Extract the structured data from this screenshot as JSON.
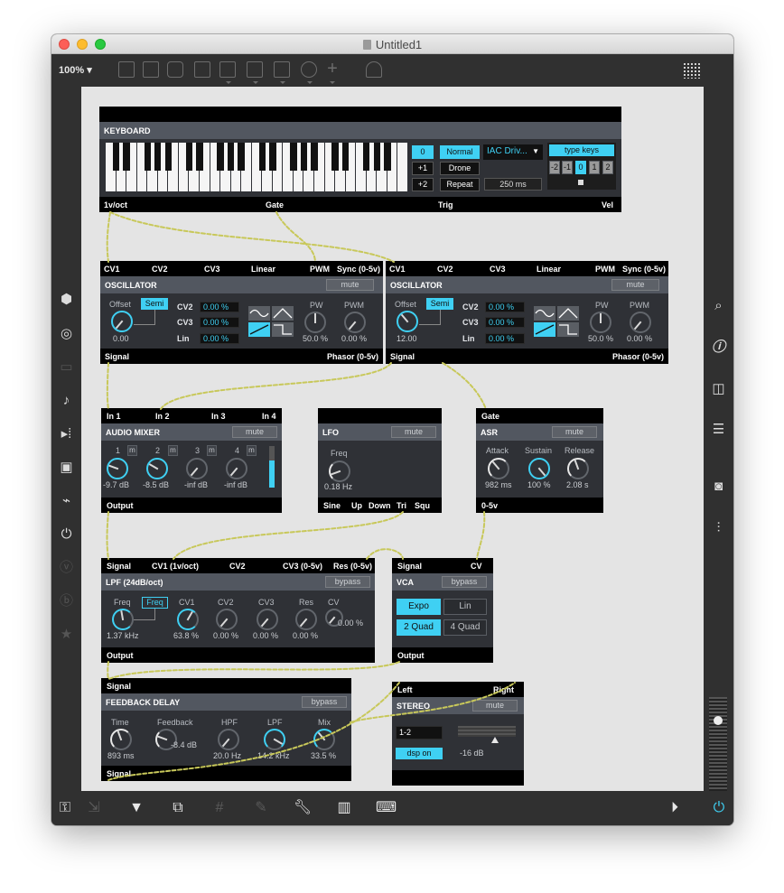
{
  "window": {
    "title": "Untitled1",
    "zoom": "100%"
  },
  "keyboard": {
    "name": "KEYBOARD",
    "octave_buttons": [
      "0",
      "+1",
      "+2"
    ],
    "mode_buttons": [
      "Normal",
      "Drone",
      "Repeat"
    ],
    "midi_device": "IAC Driv...",
    "repeat_time": "250 ms",
    "type_keys_label": "type keys",
    "type_keys_octaves": [
      "-2",
      "-1",
      "0",
      "1",
      "2"
    ],
    "outputs": [
      "1v/oct",
      "Gate",
      "Trig",
      "Vel"
    ]
  },
  "osc1": {
    "inputs": [
      "CV1",
      "CV2",
      "CV3",
      "Linear",
      "PWM",
      "Sync (0-5v)"
    ],
    "name": "OSCILLATOR",
    "mute_label": "mute",
    "offset_label": "Offset",
    "semi_label": "Semi",
    "offset_value": "0.00",
    "cv_rows": [
      {
        "label": "CV2",
        "value": "0.00 %"
      },
      {
        "label": "CV3",
        "value": "0.00 %"
      },
      {
        "label": "Lin",
        "value": "0.00 %"
      }
    ],
    "pw_label": "PW",
    "pw_value": "50.0 %",
    "pwm_label": "PWM",
    "pwm_value": "0.00 %",
    "outputs": [
      "Signal",
      "Phasor (0-5v)"
    ]
  },
  "osc2": {
    "inputs": [
      "CV1",
      "CV2",
      "CV3",
      "Linear",
      "PWM",
      "Sync (0-5v)"
    ],
    "name": "OSCILLATOR",
    "mute_label": "mute",
    "offset_label": "Offset",
    "semi_label": "Semi",
    "offset_value": "12.00",
    "cv_rows": [
      {
        "label": "CV2",
        "value": "0.00 %"
      },
      {
        "label": "CV3",
        "value": "0.00 %"
      },
      {
        "label": "Lin",
        "value": "0.00 %"
      }
    ],
    "pw_label": "PW",
    "pw_value": "50.0 %",
    "pwm_label": "PWM",
    "pwm_value": "0.00 %",
    "outputs": [
      "Signal",
      "Phasor (0-5v)"
    ]
  },
  "mixer": {
    "inputs": [
      "In 1",
      "In 2",
      "In 3",
      "In 4"
    ],
    "name": "AUDIO MIXER",
    "mute_label": "mute",
    "channels": [
      {
        "num": "1",
        "m": "m",
        "value": "-9.7 dB"
      },
      {
        "num": "2",
        "m": "m",
        "value": "-8.5 dB"
      },
      {
        "num": "3",
        "m": "m",
        "value": "-inf dB"
      },
      {
        "num": "4",
        "m": "m",
        "value": "-inf dB"
      }
    ],
    "output": "Output"
  },
  "lfo": {
    "name": "LFO",
    "mute_label": "mute",
    "freq_label": "Freq",
    "freq_value": "0.18 Hz",
    "outputs": [
      "Sine",
      "Up",
      "Down",
      "Tri",
      "Squ"
    ]
  },
  "asr": {
    "input": "Gate",
    "name": "ASR",
    "mute_label": "mute",
    "params": [
      {
        "label": "Attack",
        "value": "982 ms"
      },
      {
        "label": "Sustain",
        "value": "100 %"
      },
      {
        "label": "Release",
        "value": "2.08 s"
      }
    ],
    "output": "0-5v"
  },
  "lpf": {
    "inputs": [
      "Signal",
      "CV1 (1v/oct)",
      "CV2",
      "CV3 (0-5v)",
      "Res (0-5v)"
    ],
    "name": "LPF (24dB/oct)",
    "bypass_label": "bypass",
    "freq_label": "Freq",
    "freq_button": "Freq",
    "freq_value": "1.37 kHz",
    "params": [
      {
        "label": "CV1",
        "value": "63.8 %"
      },
      {
        "label": "CV2",
        "value": "0.00 %"
      },
      {
        "label": "CV3",
        "value": "0.00 %"
      },
      {
        "label": "Res",
        "value": "0.00 %"
      }
    ],
    "cv_label": "CV",
    "cv_value": "0.00 %",
    "output": "Output"
  },
  "vca": {
    "inputs": [
      "Signal",
      "CV"
    ],
    "name": "VCA",
    "bypass_label": "bypass",
    "buttons": [
      "Expo",
      "Lin",
      "2 Quad",
      "4 Quad"
    ],
    "output": "Output"
  },
  "delay": {
    "input": "Signal",
    "name": "FEEDBACK DELAY",
    "bypass_label": "bypass",
    "params": [
      {
        "label": "Time",
        "value": "893 ms"
      },
      {
        "label": "Feedback",
        "value": "-8.4 dB"
      },
      {
        "label": "HPF",
        "value": "20.0 Hz"
      },
      {
        "label": "LPF",
        "value": "14.2 kHz"
      },
      {
        "label": "Mix",
        "value": "33.5 %"
      }
    ],
    "output": "Signal"
  },
  "stereo": {
    "inputs": [
      "Left",
      "Right"
    ],
    "name": "STEREO",
    "mute_label": "mute",
    "channel_value": "1-2",
    "dsp_label": "dsp on",
    "gain_value": "-16 dB"
  },
  "colors": {
    "accent": "#3fd0f3",
    "panel": "#2f3136",
    "header": "#525760",
    "cable": "#c8c85a"
  }
}
